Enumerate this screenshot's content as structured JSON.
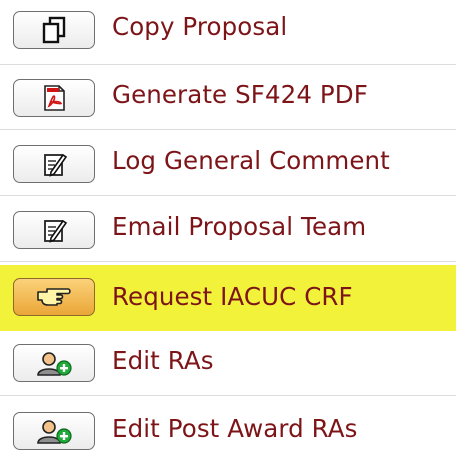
{
  "menu": {
    "items": [
      {
        "label": "Copy Proposal",
        "icon": "copy-icon"
      },
      {
        "label": "Generate SF424 PDF",
        "icon": "pdf-icon"
      },
      {
        "label": "Log General Comment",
        "icon": "notepad-pencil-icon"
      },
      {
        "label": "Email Proposal Team",
        "icon": "notepad-pencil-icon"
      },
      {
        "label": "Request IACUC CRF",
        "icon": "pointing-hand-icon",
        "highlighted": true
      },
      {
        "label": "Edit RAs",
        "icon": "user-add-icon"
      },
      {
        "label": "Edit Post Award RAs",
        "icon": "user-add-icon"
      }
    ]
  },
  "colors": {
    "label": "#7c1418",
    "highlight": "#f2f23a",
    "highlight_button": "#f0b24a",
    "separator": "#dcdcdc",
    "add_badge": "#1faa3a"
  }
}
